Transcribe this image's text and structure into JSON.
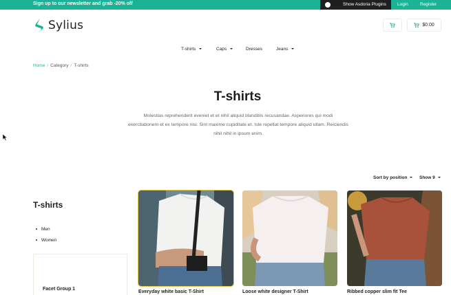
{
  "topbar": {
    "promo": "Sign up to our newsletter and grab -20% off",
    "plugins_label": "Show Asdoria Plugins",
    "login": "Login",
    "register": "Register"
  },
  "header": {
    "logo_text": "Sylius",
    "cart_total": "$0.00"
  },
  "nav": {
    "items": [
      "T-shirts",
      "Caps",
      "Dresses",
      "Jeans"
    ]
  },
  "breadcrumb": {
    "home": "Home",
    "category": "Category",
    "current": "T-shirts"
  },
  "hero": {
    "title": "T-shirts",
    "description": "Molestias reprehenderit eveniet et et nihil aliquid blanditiis recusandae. Asperiores qui modi exercitationem et ex tempore nisi. Sint maxime cupiditate et. Iste repellat tempore aliquid ullam. Reiciendis nihil nihil in ipsum enim."
  },
  "sorting": {
    "sort_label": "Sort by position",
    "show_label": "Show 9"
  },
  "sidebar": {
    "title": "T-shirts",
    "items": [
      "Men",
      "Women"
    ],
    "facet_title": "Facet Group 1"
  },
  "products": [
    {
      "name": "Everyday white basic T-Shirt",
      "image": "white t-shirt with bag"
    },
    {
      "name": "Loose white designer T-Shirt",
      "image": "loose white t-shirt"
    },
    {
      "name": "Ribbed copper slim fit Tee",
      "image": "copper tee"
    }
  ],
  "colors": {
    "accent": "#1cb295",
    "dark": "#1f1f1f"
  }
}
